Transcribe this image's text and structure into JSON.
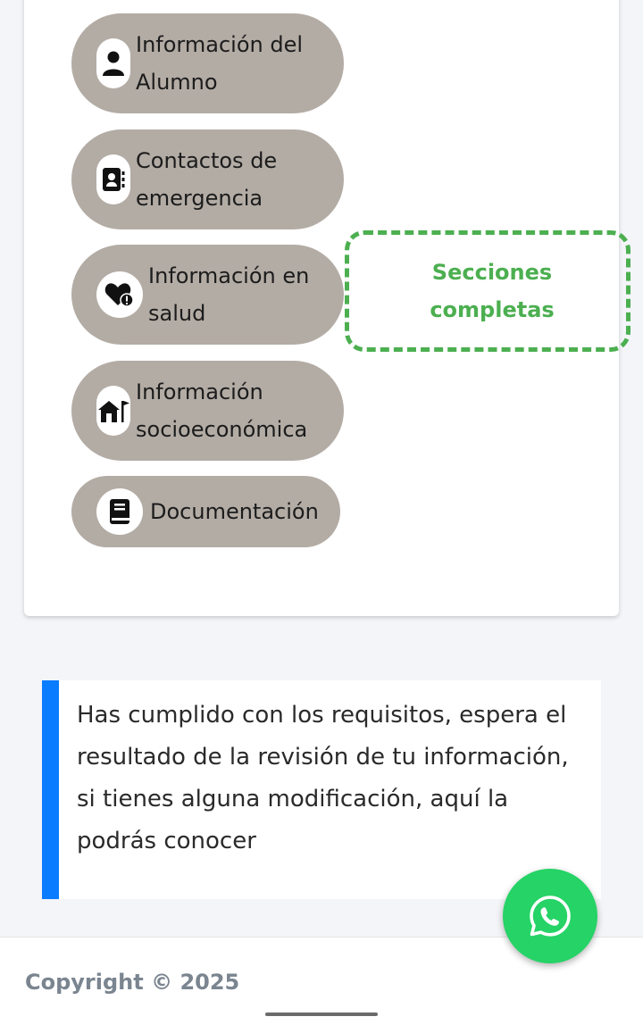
{
  "sections": [
    {
      "label_line1": "Información del",
      "label_line2": "Alumno",
      "icon": "user-icon"
    },
    {
      "label_line1": "Contactos de",
      "label_line2": "emergencia",
      "icon": "contact-book-icon"
    },
    {
      "label_line1": "Información en",
      "label_line2": "salud",
      "icon": "heart-alert-icon"
    },
    {
      "label_line1": "Información",
      "label_line2": "socioeconómica",
      "icon": "house-flag-icon"
    },
    {
      "label_line1": "Documentación",
      "icon": "book-icon"
    }
  ],
  "status": {
    "line1": "Secciones",
    "line2": "completas",
    "color": "#4caf50"
  },
  "notice": {
    "text": "Has cumplido con los requisitos, espera el resultado de la revisión de tu información, si tienes alguna modificación, aquí la podrás conocer",
    "accent": "#0a7cff"
  },
  "footer": {
    "copyright": "Copyright © 2025"
  },
  "whatsapp": {
    "icon": "whatsapp-icon",
    "color": "#25d366"
  },
  "colors": {
    "section_bg": "#b3aca5",
    "page_bg": "#f4f5f9"
  }
}
